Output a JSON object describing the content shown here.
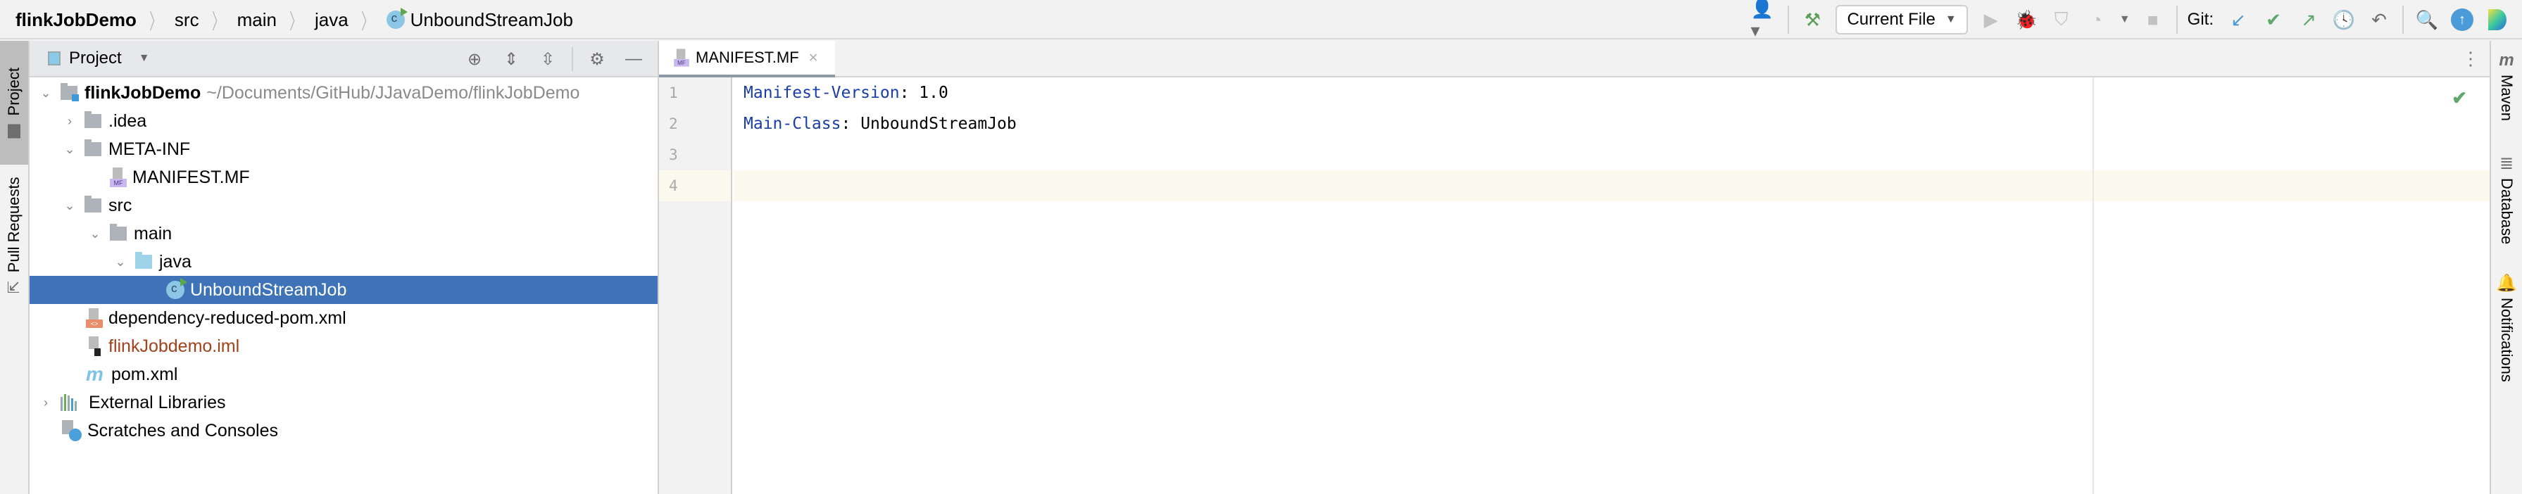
{
  "breadcrumb": {
    "items": [
      "flinkJobDemo",
      "src",
      "main",
      "java",
      "UnboundStreamJob"
    ]
  },
  "toolbar": {
    "run_config": "Current File",
    "git_label": "Git:",
    "icons": [
      "user-icon",
      "build-hammer-icon",
      "run-icon",
      "debug-icon",
      "coverage-icon",
      "profile-icon",
      "stop-icon",
      "git-update-icon",
      "git-commit-icon",
      "git-push-icon",
      "git-history-icon",
      "git-rollback-icon",
      "search-icon",
      "update-icon",
      "toolbox-icon"
    ]
  },
  "left_strip": {
    "tabs": [
      {
        "label": "Project",
        "icon": "folder-icon",
        "active": true
      },
      {
        "label": "Pull Requests",
        "icon": "pull-request-icon",
        "active": false
      }
    ]
  },
  "project_panel": {
    "title": "Project",
    "tree": [
      {
        "label": "flinkJobDemo",
        "path": "~/Documents/GitHub/JJavaDemo/flinkJobDemo",
        "type": "module",
        "expanded": true,
        "depth": 0
      },
      {
        "label": ".idea",
        "type": "folder",
        "expanded": false,
        "depth": 1
      },
      {
        "label": "META-INF",
        "type": "folder",
        "expanded": true,
        "depth": 1
      },
      {
        "label": "MANIFEST.MF",
        "type": "manifest",
        "depth": 2
      },
      {
        "label": "src",
        "type": "folder",
        "expanded": true,
        "depth": 1
      },
      {
        "label": "main",
        "type": "folder",
        "expanded": true,
        "depth": 2
      },
      {
        "label": "java",
        "type": "source-folder",
        "expanded": true,
        "depth": 3
      },
      {
        "label": "UnboundStreamJob",
        "type": "class",
        "selected": true,
        "depth": 4
      },
      {
        "label": "dependency-reduced-pom.xml",
        "type": "xml",
        "depth": 1
      },
      {
        "label": "flinkJobdemo.iml",
        "type": "iml",
        "depth": 1
      },
      {
        "label": "pom.xml",
        "type": "maven",
        "depth": 1
      },
      {
        "label": "External Libraries",
        "type": "libraries",
        "expanded": false,
        "depth": 0
      },
      {
        "label": "Scratches and Consoles",
        "type": "scratches",
        "depth": 0
      }
    ]
  },
  "editor": {
    "tab": {
      "label": "MANIFEST.MF",
      "close": "×"
    },
    "lines": [
      {
        "num": "1",
        "key": "Manifest-Version",
        "sep": ": ",
        "value": "1.0"
      },
      {
        "num": "2",
        "key": "Main-Class",
        "sep": ": ",
        "value": "UnboundStreamJob"
      },
      {
        "num": "3",
        "key": "",
        "sep": "",
        "value": ""
      },
      {
        "num": "4",
        "key": "",
        "sep": "",
        "value": ""
      }
    ],
    "current_line": 4
  },
  "right_strip": {
    "tabs": [
      {
        "label": "Maven",
        "icon": "maven-icon"
      },
      {
        "label": "Database",
        "icon": "database-icon"
      },
      {
        "label": "Notifications",
        "icon": "bell-icon"
      }
    ]
  }
}
